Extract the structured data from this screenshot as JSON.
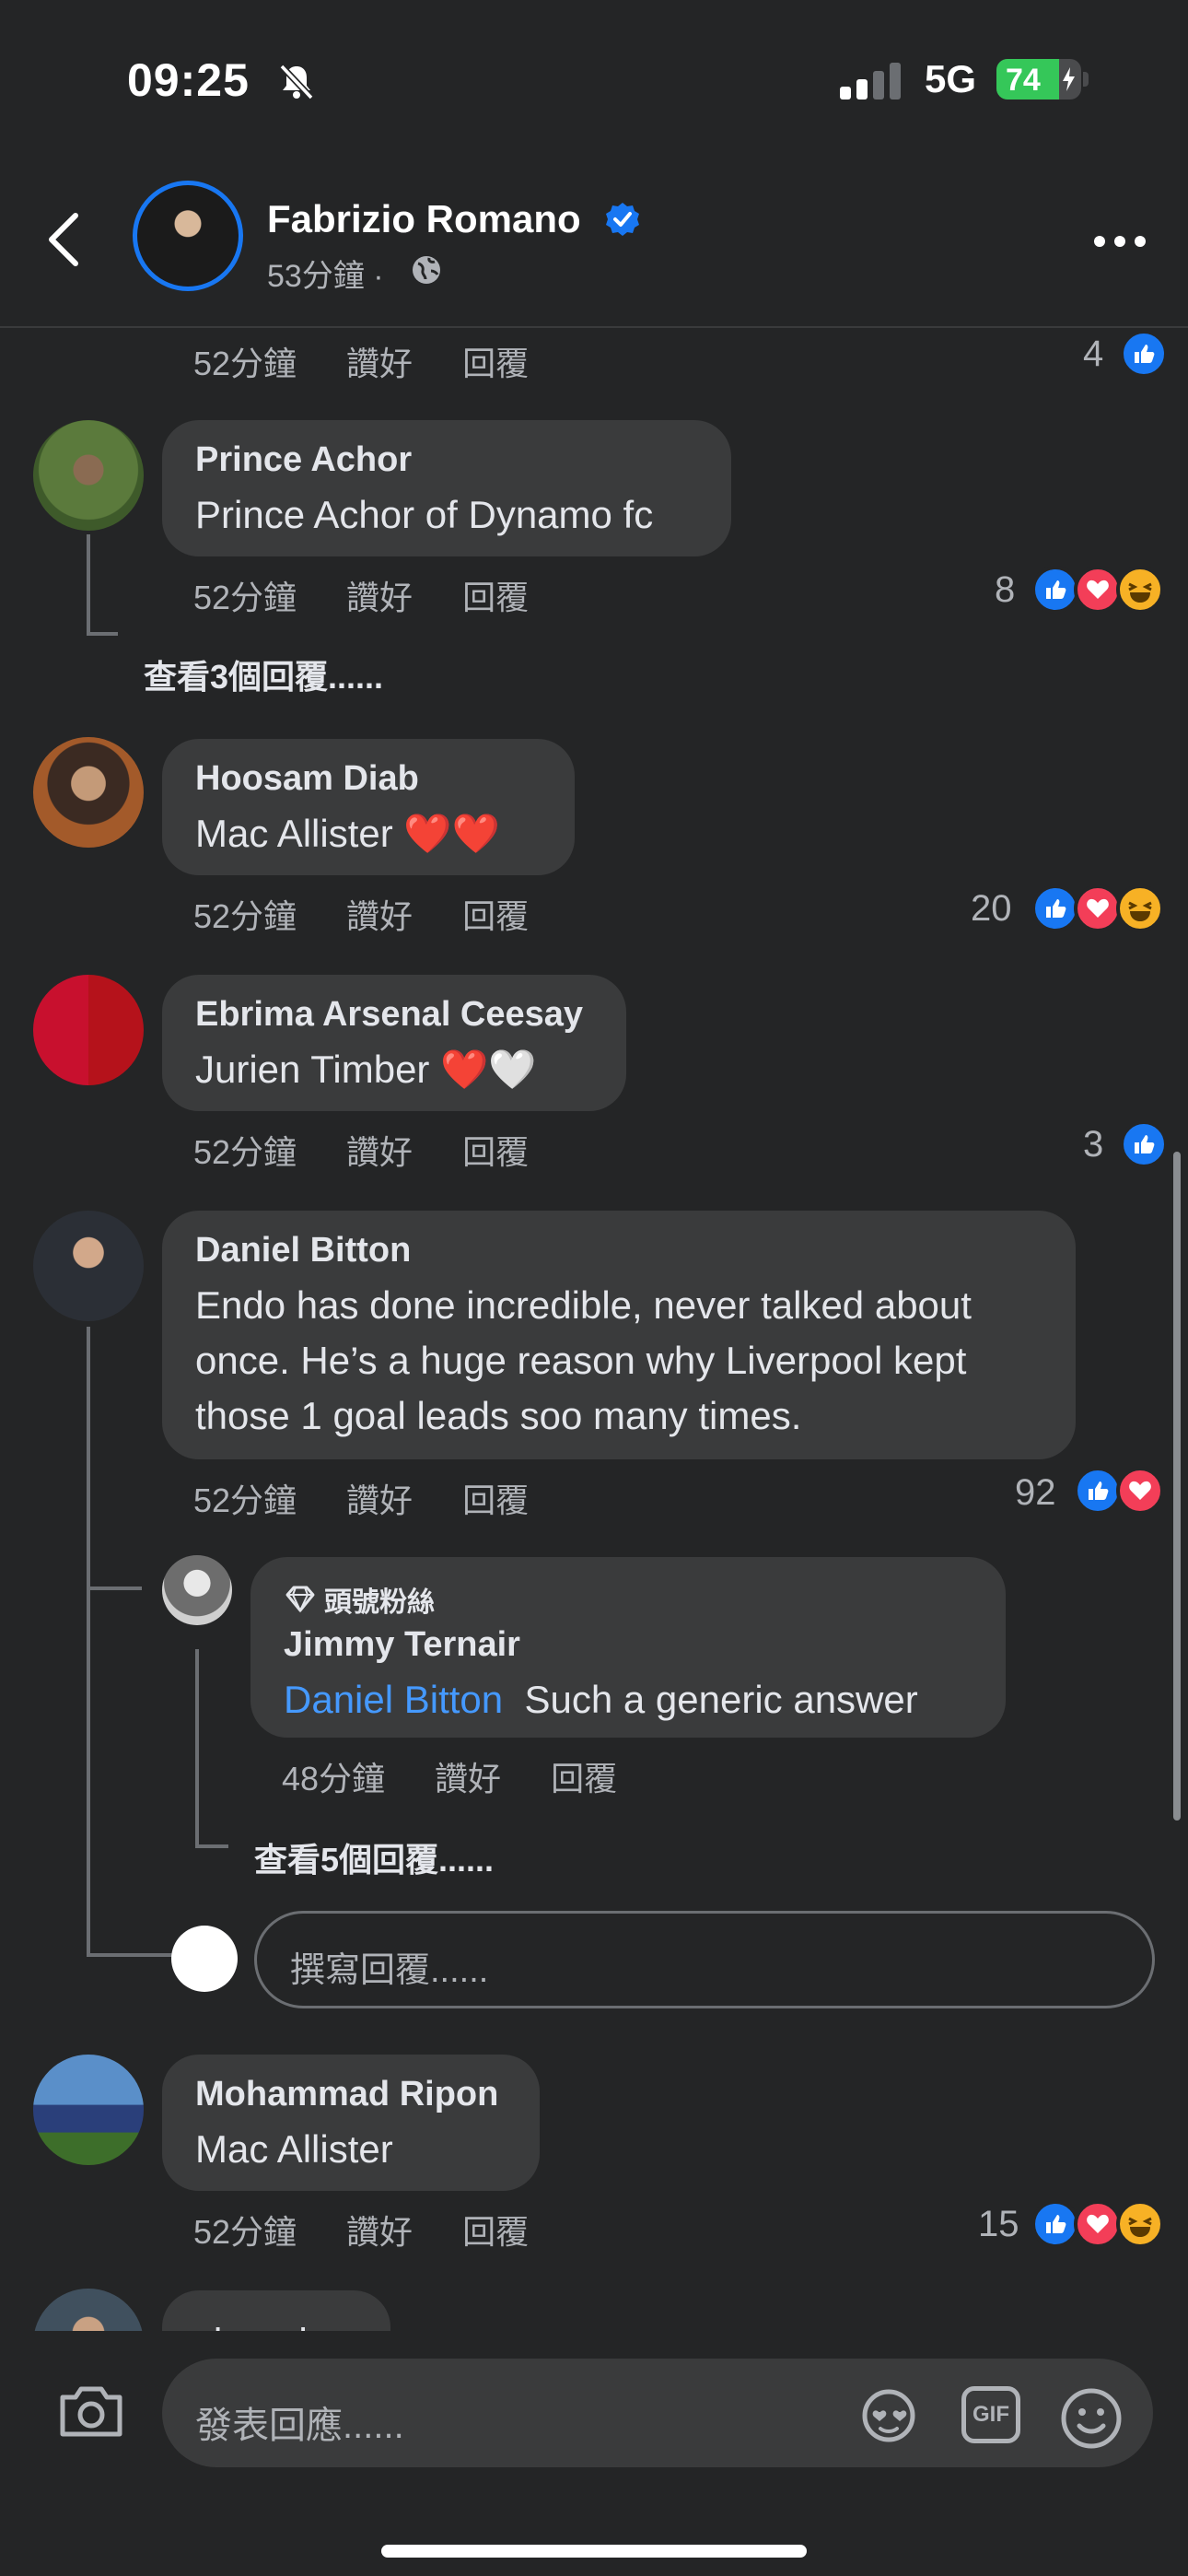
{
  "status": {
    "time": "09:25",
    "network": "5G",
    "battery": "74",
    "battery_level": 0.74
  },
  "header": {
    "name": "Fabrizio Romano",
    "subtitle": "53分鐘 ·"
  },
  "top_meta": {
    "time": "52分鐘",
    "like": "讚好",
    "reply": "回覆",
    "count": "4"
  },
  "comments": [
    {
      "name": "Prince Achor",
      "text": "Prince Achor of Dynamo fc",
      "time": "52分鐘",
      "like": "讚好",
      "reply": "回覆",
      "count": "8",
      "view_more": "查看3個回覆......"
    },
    {
      "name": "Hoosam Diab",
      "text": "Mac Allister ❤️❤️",
      "time": "52分鐘",
      "like": "讚好",
      "reply": "回覆",
      "count": "20"
    },
    {
      "name": "Ebrima Arsenal Ceesay",
      "text": "Jurien Timber ❤️🤍",
      "time": "52分鐘",
      "like": "讚好",
      "reply": "回覆",
      "count": "3"
    },
    {
      "name": "Daniel Bitton",
      "text_lines": [
        "Endo has done incredible, never talked about",
        "once. He’s a huge reason why Liverpool kept",
        "those 1 goal leads soo many times."
      ],
      "time": "52分鐘",
      "like": "讚好",
      "reply": "回覆",
      "count": "92"
    },
    {
      "name": "Mohammad Ripon",
      "text": "Mac Allister",
      "time": "52分鐘",
      "like": "讚好",
      "reply": "回覆",
      "count": "15"
    }
  ],
  "reply": {
    "badge": "頭號粉絲",
    "name": "Jimmy Ternair",
    "mention": "Daniel Bitton",
    "text": "Such a generic answer",
    "time": "48分鐘",
    "like": "讚好",
    "reply": "回覆",
    "view_more": "查看5個回覆......"
  },
  "reply_box": {
    "placeholder": "撰寫回覆......"
  },
  "partial_comment": {
    "text": "عماد عماد"
  },
  "composer": {
    "placeholder": "發表回應......",
    "gif": "GIF"
  },
  "colors": {
    "bg": "#242526",
    "bubble": "#3a3b3c",
    "like": "#1877f2",
    "love": "#f33e58",
    "haha": "#f7b125",
    "mention": "#4599ff"
  }
}
